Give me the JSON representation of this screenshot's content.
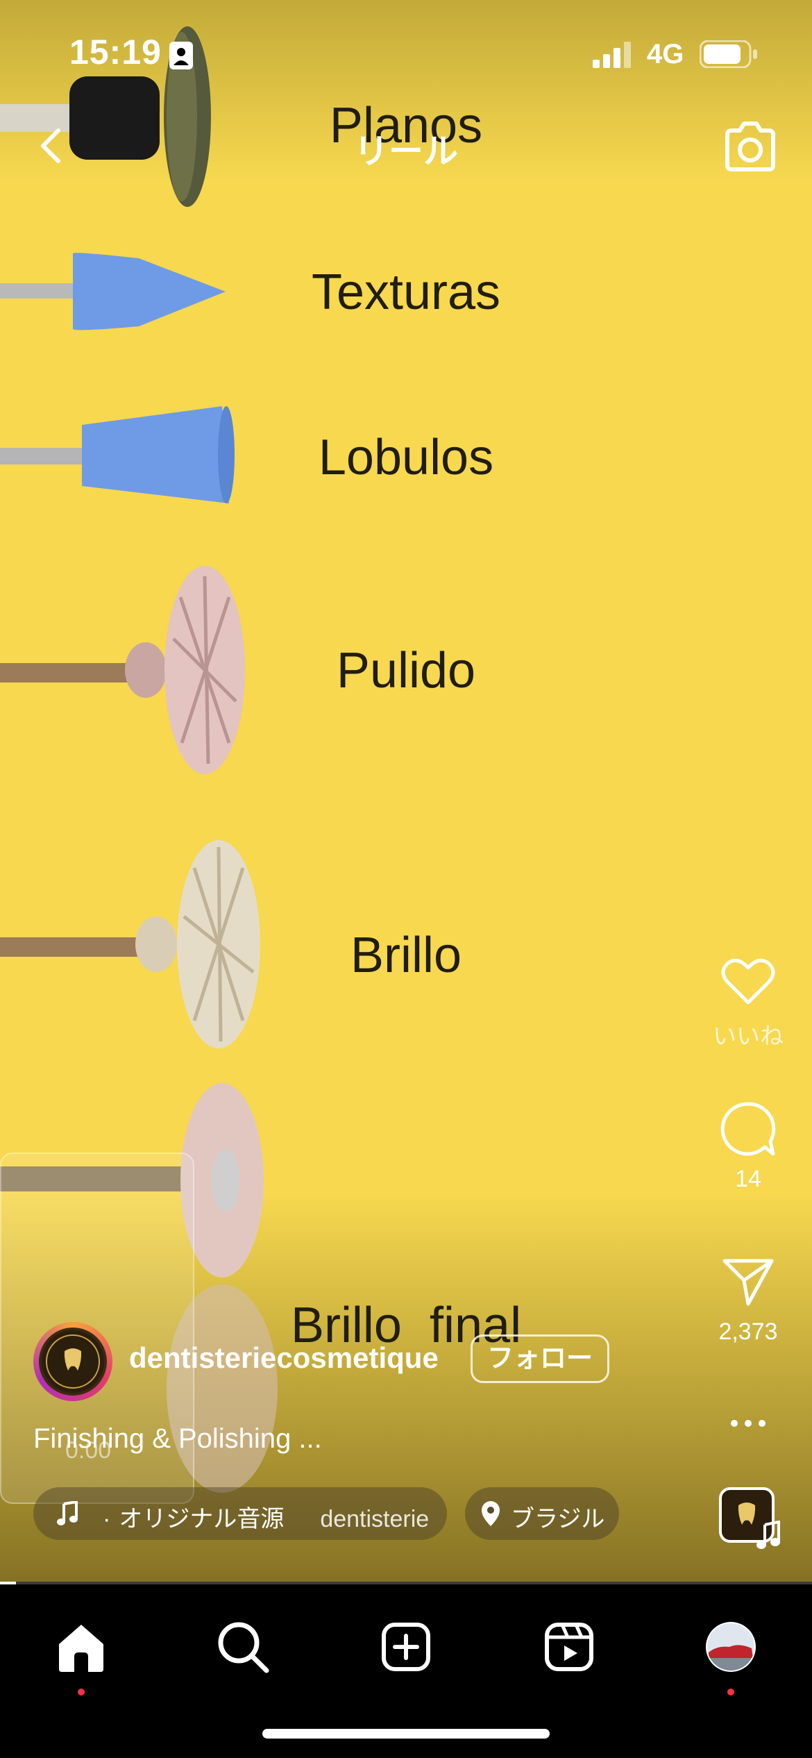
{
  "status_bar": {
    "time": "15:19",
    "network": "4G",
    "battery_level": 0.85
  },
  "header": {
    "title": "リール"
  },
  "video": {
    "labels": [
      "Planos",
      "Texturas",
      "Lobulos",
      "Pulido",
      "Brillo",
      "Brillo  final"
    ],
    "thumb_time": "0:00"
  },
  "actions": {
    "like": {
      "icon": "heart-icon",
      "label": "いいね"
    },
    "comment": {
      "icon": "comment-icon",
      "count": "14"
    },
    "share": {
      "icon": "send-icon",
      "count": "2,373"
    },
    "more": {
      "icon": "more-icon"
    }
  },
  "post": {
    "username": "dentisteriecosmetique",
    "follow_label": "フォロー",
    "caption": "Finishing & Polishing ...",
    "audio_prefix": "·",
    "audio_title": "オリジナル音源",
    "audio_artist": "dentisterie",
    "location": "ブラジル"
  },
  "playback_progress": 0.02,
  "tabbar": {
    "tabs": [
      "home",
      "search",
      "create",
      "reels",
      "profile"
    ],
    "notifications": [
      "home",
      "profile"
    ]
  },
  "colors": {
    "background": "#f7d84f",
    "text_on_video": "#201d13",
    "badge": "#ff3040"
  }
}
